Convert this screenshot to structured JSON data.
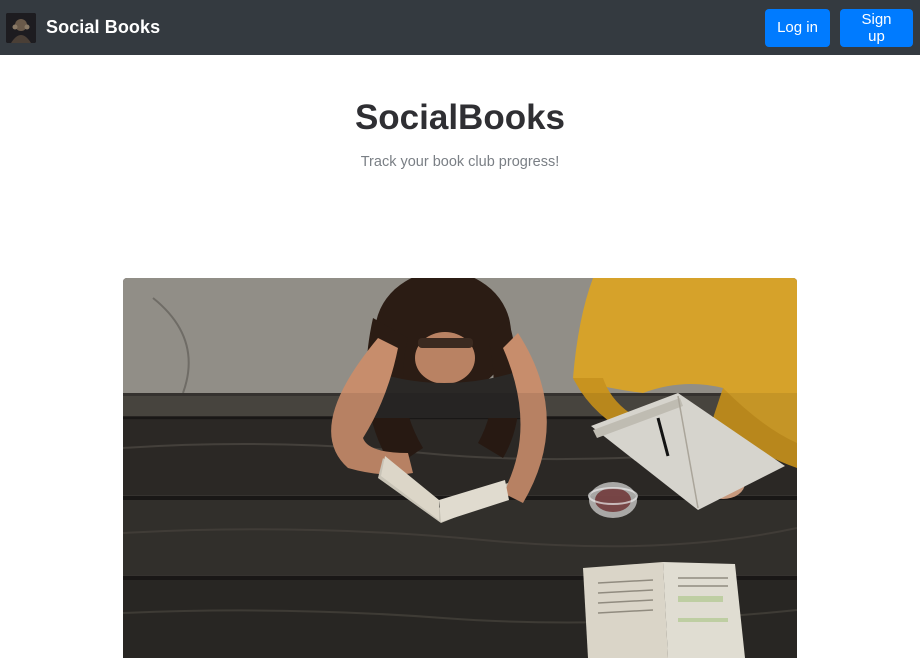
{
  "navbar": {
    "brand_name": "Social Books",
    "logo_icon": "brand-logo-icon",
    "login_label": "Log in",
    "signup_label": "Sign up"
  },
  "hero": {
    "title": "SocialBooks",
    "subtitle": "Track your book club progress!",
    "image_icon": "people-reading-photo"
  },
  "colors": {
    "navbar_bg": "#343a40",
    "button_bg": "#007bff",
    "button_text": "#ffffff",
    "title_text": "#2f2f33",
    "subtitle_text": "#7a7f85"
  }
}
